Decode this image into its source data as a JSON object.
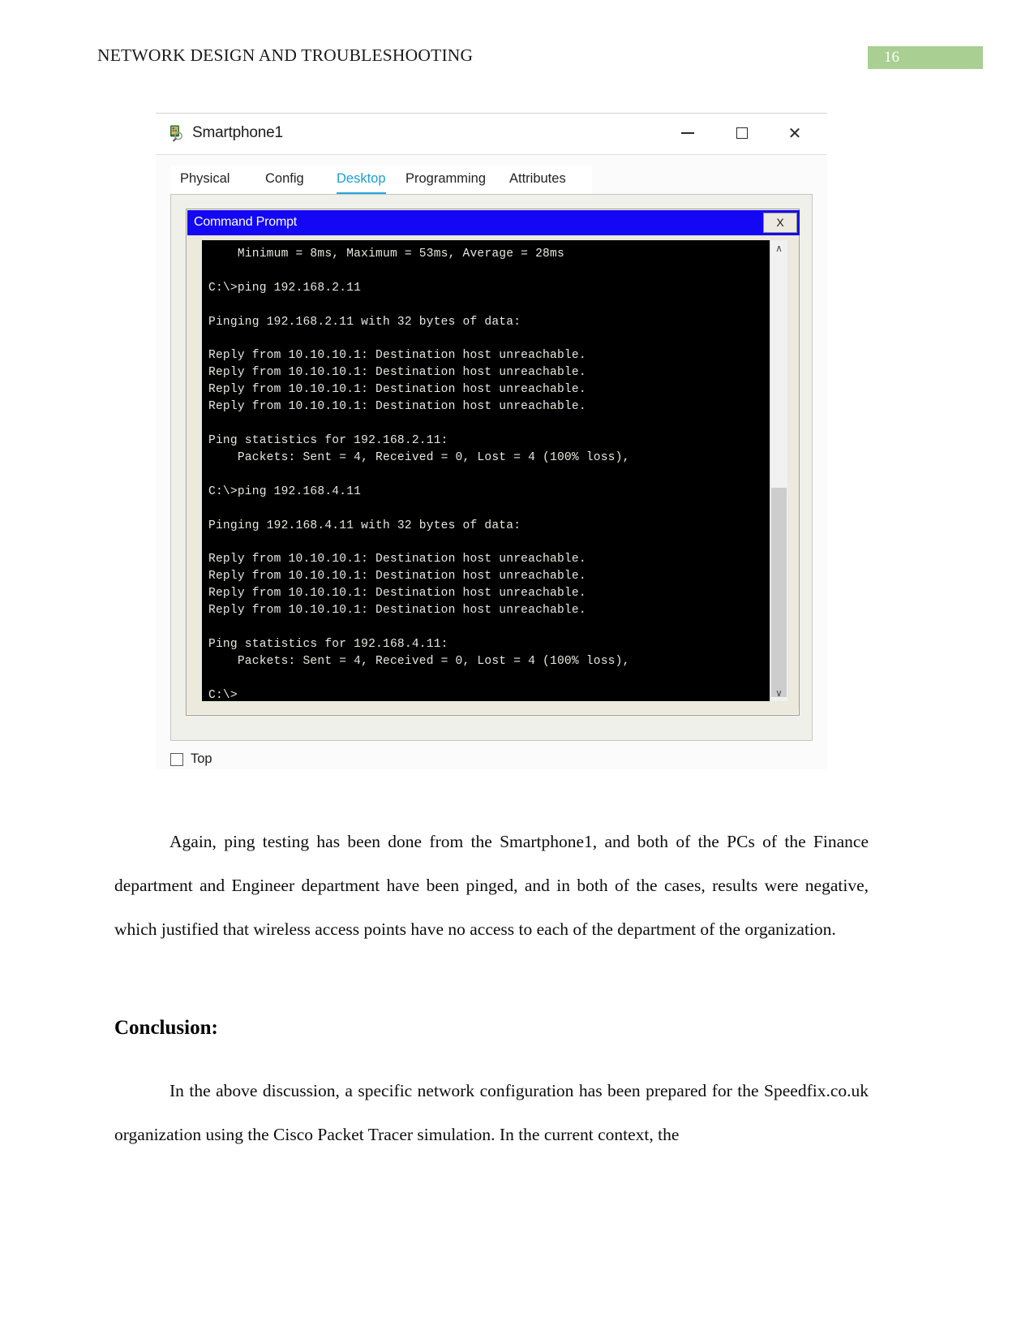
{
  "document": {
    "header_title": "NETWORK DESIGN AND TROUBLESHOOTING",
    "page_number": "16",
    "accent_green": "#a9cf92"
  },
  "figure": {
    "window": {
      "title": "Smartphone1",
      "icon": "packet-tracer-smartphone-icon",
      "minimize_label": "—",
      "maximize_label": "❐",
      "close_label": "✕"
    },
    "tabs": [
      {
        "label": "Physical",
        "active": false
      },
      {
        "label": "Config",
        "active": false
      },
      {
        "label": "Desktop",
        "active": true
      },
      {
        "label": "Programming",
        "active": false
      },
      {
        "label": "Attributes",
        "active": false
      }
    ],
    "tab_active_color": "#1a9fd4",
    "command_prompt": {
      "title": "Command Prompt",
      "titlebar_color": "#1407f3",
      "close_label": "X",
      "terminal_background": "#000000",
      "terminal_text_color": "#e8e8e0",
      "terminal_lines": "    Minimum = 8ms, Maximum = 53ms, Average = 28ms\n\nC:\\>ping 192.168.2.11\n\nPinging 192.168.2.11 with 32 bytes of data:\n\nReply from 10.10.10.1: Destination host unreachable.\nReply from 10.10.10.1: Destination host unreachable.\nReply from 10.10.10.1: Destination host unreachable.\nReply from 10.10.10.1: Destination host unreachable.\n\nPing statistics for 192.168.2.11:\n    Packets: Sent = 4, Received = 0, Lost = 4 (100% loss),\n\nC:\\>ping 192.168.4.11\n\nPinging 192.168.4.11 with 32 bytes of data:\n\nReply from 10.10.10.1: Destination host unreachable.\nReply from 10.10.10.1: Destination host unreachable.\nReply from 10.10.10.1: Destination host unreachable.\nReply from 10.10.10.1: Destination host unreachable.\n\nPing statistics for 192.168.4.11:\n    Packets: Sent = 4, Received = 0, Lost = 4 (100% loss),\n\nC:\\>",
      "scrollbar": {
        "up_arrow": "∧",
        "down_arrow": "∨"
      }
    },
    "top_checkbox": {
      "label": "Top",
      "checked": false
    }
  },
  "body": {
    "paragraph_1": "Again, ping testing has been done from the Smartphone1, and both of the PCs of the Finance department and Engineer department have been pinged, and in both of the cases, results were negative, which justified that wireless access points have no access to each of the department of the organization.",
    "conclusion_heading": "Conclusion:",
    "paragraph_2": "In the above discussion, a specific network configuration has been prepared for the Speedfix.co.uk organization using the Cisco Packet Tracer simulation. In the current context, the"
  }
}
